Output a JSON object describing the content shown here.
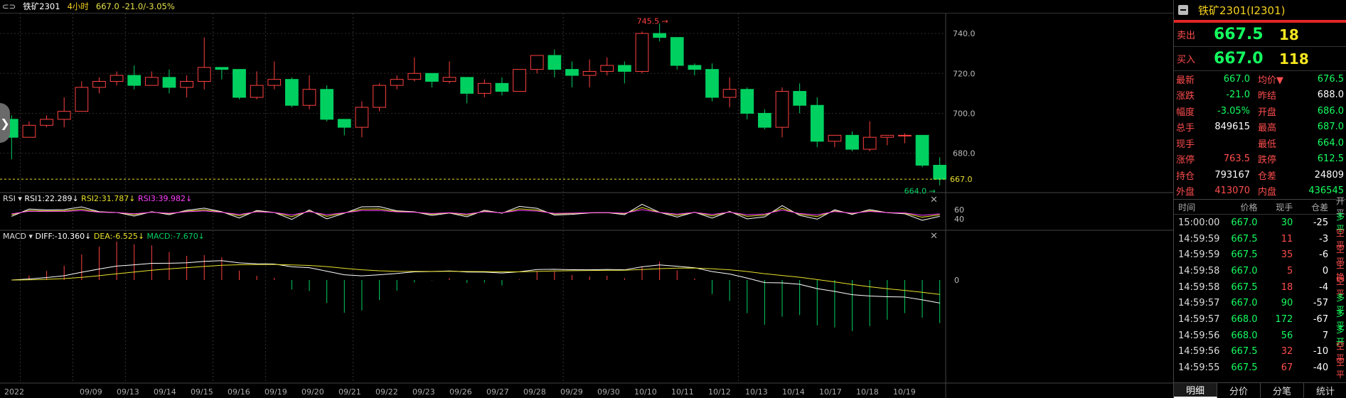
{
  "topbar": {
    "symbol": "铁矿2301",
    "period": "4小时",
    "quote": "667.0  -21.0/-3.05%"
  },
  "chart_data": {
    "type": "candlestick",
    "price_axis": {
      "ticks": [
        "740.0",
        "720.0",
        "700.0",
        "680.0"
      ],
      "min": 661,
      "max": 750,
      "current": "667.0"
    },
    "date_labels": [
      "2022",
      "09/09",
      "09/13",
      "09/14",
      "09/15",
      "09/16",
      "09/19",
      "09/20",
      "09/21",
      "09/22",
      "09/23",
      "09/26",
      "09/27",
      "09/28",
      "09/29",
      "09/30",
      "10/10",
      "10/11",
      "10/12",
      "10/13",
      "10/14",
      "10/17",
      "10/18",
      "10/19"
    ],
    "candles": [
      [
        697,
        688,
        699,
        677
      ],
      [
        688,
        694,
        696,
        688
      ],
      [
        694,
        697,
        699,
        693
      ],
      [
        697,
        701,
        708,
        693
      ],
      [
        701,
        713,
        716,
        701
      ],
      [
        713,
        716,
        718,
        710
      ],
      [
        716,
        719,
        721,
        714
      ],
      [
        719,
        714,
        724,
        712
      ],
      [
        714,
        718,
        721,
        714
      ],
      [
        718,
        713,
        722,
        710
      ],
      [
        713,
        716,
        719,
        708
      ],
      [
        716,
        723,
        738,
        712
      ],
      [
        723,
        722,
        723,
        717
      ],
      [
        722,
        708,
        722,
        707
      ],
      [
        708,
        714,
        721,
        707
      ],
      [
        714,
        717,
        726,
        712
      ],
      [
        717,
        704,
        718,
        703
      ],
      [
        704,
        712,
        719,
        702
      ],
      [
        712,
        697,
        714,
        696
      ],
      [
        697,
        693,
        697,
        689
      ],
      [
        693,
        703,
        706,
        688
      ],
      [
        703,
        714,
        715,
        701
      ],
      [
        714,
        717,
        719,
        712
      ],
      [
        717,
        720,
        728,
        716
      ],
      [
        720,
        716,
        719,
        713
      ],
      [
        716,
        718,
        726,
        715
      ],
      [
        718,
        710,
        718,
        705
      ],
      [
        710,
        715,
        717,
        708
      ],
      [
        715,
        711,
        718,
        709
      ],
      [
        711,
        722,
        722,
        711
      ],
      [
        722,
        729,
        729,
        720
      ],
      [
        729,
        722,
        732,
        718
      ],
      [
        722,
        719,
        726,
        713
      ],
      [
        719,
        721,
        727,
        713
      ],
      [
        721,
        724,
        728,
        719
      ],
      [
        724,
        721,
        726,
        715
      ],
      [
        721,
        740,
        741,
        720
      ],
      [
        740,
        738,
        745,
        736
      ],
      [
        738,
        724,
        738,
        722
      ],
      [
        724,
        722,
        725,
        719
      ],
      [
        722,
        708,
        725,
        706
      ],
      [
        708,
        712,
        718,
        703
      ],
      [
        712,
        700,
        713,
        697
      ],
      [
        700,
        693,
        702,
        692
      ],
      [
        693,
        711,
        713,
        688
      ],
      [
        711,
        704,
        715,
        700
      ],
      [
        704,
        686,
        708,
        683
      ],
      [
        686,
        689,
        689,
        683
      ],
      [
        689,
        682,
        691,
        681
      ],
      [
        682,
        688,
        696,
        681
      ],
      [
        688,
        689,
        689,
        684
      ],
      [
        689,
        689,
        690,
        685
      ],
      [
        689,
        674,
        689,
        673
      ],
      [
        674,
        667,
        678,
        664
      ]
    ],
    "rsi": {
      "RSI1": "22.289",
      "RSI2": "31.787",
      "RSI3": "39.982",
      "levels": [
        "60",
        "40"
      ]
    },
    "macd": {
      "DIFF": "-10.360",
      "DEA": "-6.525",
      "MACD": "-7.670",
      "zero": "0"
    },
    "annotations": {
      "high": "745.5",
      "low": "664.0"
    }
  },
  "side": {
    "title": "铁矿2301(I2301)",
    "ask": {
      "label": "卖出",
      "price": "667.5",
      "vol": "18"
    },
    "bid": {
      "label": "买入",
      "price": "667.0",
      "vol": "118"
    },
    "stats": [
      [
        "最新",
        "667.0",
        "均价▼",
        "676.5"
      ],
      [
        "涨跌",
        "-21.0",
        "昨结",
        "688.0"
      ],
      [
        "幅度",
        "-3.05%",
        "开盘",
        "686.0"
      ],
      [
        "总手",
        "849615",
        "最高",
        "687.0"
      ],
      [
        "现手",
        "",
        "最低",
        "664.0"
      ],
      [
        "涨停",
        "763.5",
        "跌停",
        "612.5"
      ],
      [
        "持仓",
        "793167",
        "仓差",
        "24809"
      ],
      [
        "外盘",
        "413070",
        "内盘",
        "436545"
      ]
    ],
    "tick_header": [
      "时间",
      "价格",
      "现手",
      "仓差",
      "开平"
    ],
    "ticks": [
      [
        "15:00:00",
        "667.0",
        "30",
        "-25",
        "多平"
      ],
      [
        "14:59:59",
        "667.5",
        "11",
        "-3",
        "空平"
      ],
      [
        "14:59:59",
        "667.5",
        "35",
        "-6",
        "空平"
      ],
      [
        "14:59:58",
        "667.0",
        "5",
        "0",
        "空换"
      ],
      [
        "14:59:58",
        "667.5",
        "18",
        "-4",
        "空平"
      ],
      [
        "14:59:57",
        "667.0",
        "90",
        "-57",
        "多平"
      ],
      [
        "14:59:57",
        "668.0",
        "172",
        "-67",
        "多平"
      ],
      [
        "14:59:56",
        "668.0",
        "56",
        "7",
        "多开"
      ],
      [
        "14:59:56",
        "667.5",
        "32",
        "-10",
        "空平"
      ],
      [
        "14:59:55",
        "667.5",
        "67",
        "-40",
        "空平"
      ]
    ],
    "tabs": [
      "明细",
      "分价",
      "分笔",
      "统计"
    ]
  }
}
